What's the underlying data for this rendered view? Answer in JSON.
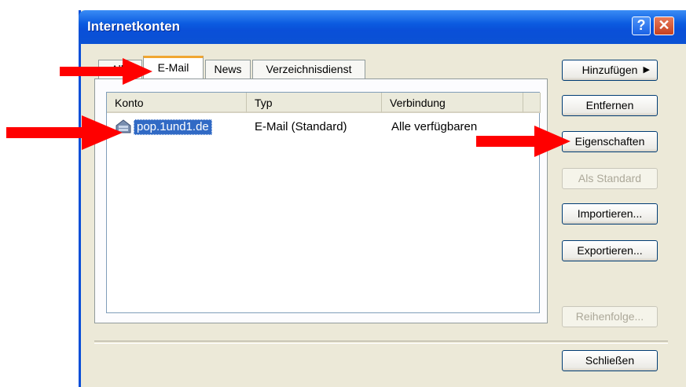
{
  "window": {
    "title": "Internetkonten"
  },
  "tabs": [
    {
      "label": "Alle",
      "active": false
    },
    {
      "label": "E-Mail",
      "active": true
    },
    {
      "label": "News",
      "active": false
    },
    {
      "label": "Verzeichnisdienst",
      "active": false
    }
  ],
  "list": {
    "columns": [
      "Konto",
      "Typ",
      "Verbindung"
    ],
    "rows": [
      {
        "konto": "pop.1und1.de",
        "typ": "E-Mail (Standard)",
        "verbindung": "Alle verfügbaren",
        "selected": true
      }
    ]
  },
  "buttons": {
    "hinzufuegen": "Hinzufügen",
    "entfernen": "Entfernen",
    "eigenschaften": "Eigenschaften",
    "als_standard": "Als Standard",
    "importieren": "Importieren...",
    "exportieren": "Exportieren...",
    "reihenfolge": "Reihenfolge...",
    "schliessen": "Schließen"
  },
  "annotations": {
    "arrow_color": "#ff0000"
  },
  "icons": [
    "help-icon",
    "close-icon",
    "mail-account-icon",
    "dropdown-arrow-icon"
  ]
}
